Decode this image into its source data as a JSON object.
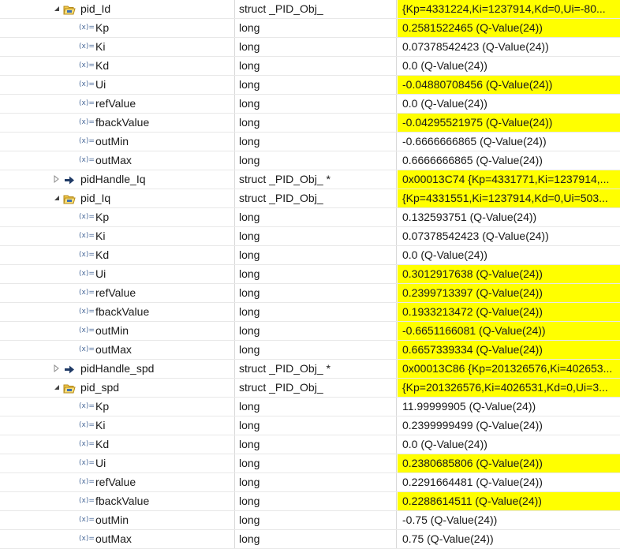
{
  "rows": [
    {
      "level": 1,
      "expand": "expanded",
      "icon": "struct-icon",
      "name": "pid_Id",
      "type": "struct _PID_Obj_",
      "value": "{Kp=4331224,Ki=1237914,Kd=0,Ui=-80...",
      "changed": true
    },
    {
      "level": 2,
      "expand": "none",
      "icon": "variable-icon",
      "name": "Kp",
      "type": "long",
      "value": "0.2581522465 (Q-Value(24))",
      "changed": true
    },
    {
      "level": 2,
      "expand": "none",
      "icon": "variable-icon",
      "name": "Ki",
      "type": "long",
      "value": "0.07378542423 (Q-Value(24))",
      "changed": false
    },
    {
      "level": 2,
      "expand": "none",
      "icon": "variable-icon",
      "name": "Kd",
      "type": "long",
      "value": "0.0 (Q-Value(24))",
      "changed": false
    },
    {
      "level": 2,
      "expand": "none",
      "icon": "variable-icon",
      "name": "Ui",
      "type": "long",
      "value": "-0.04880708456 (Q-Value(24))",
      "changed": true
    },
    {
      "level": 2,
      "expand": "none",
      "icon": "variable-icon",
      "name": "refValue",
      "type": "long",
      "value": "0.0 (Q-Value(24))",
      "changed": false
    },
    {
      "level": 2,
      "expand": "none",
      "icon": "variable-icon",
      "name": "fbackValue",
      "type": "long",
      "value": "-0.04295521975 (Q-Value(24))",
      "changed": true
    },
    {
      "level": 2,
      "expand": "none",
      "icon": "variable-icon",
      "name": "outMin",
      "type": "long",
      "value": "-0.6666666865 (Q-Value(24))",
      "changed": false
    },
    {
      "level": 2,
      "expand": "none",
      "icon": "variable-icon",
      "name": "outMax",
      "type": "long",
      "value": "0.6666666865 (Q-Value(24))",
      "changed": false
    },
    {
      "level": 1,
      "expand": "collapsed",
      "icon": "pointer-icon",
      "name": "pidHandle_Iq",
      "type": "struct _PID_Obj_ *",
      "value": "0x00013C74 {Kp=4331771,Ki=1237914,...",
      "changed": true
    },
    {
      "level": 1,
      "expand": "expanded",
      "icon": "struct-icon",
      "name": "pid_Iq",
      "type": "struct _PID_Obj_",
      "value": "{Kp=4331551,Ki=1237914,Kd=0,Ui=503...",
      "changed": true
    },
    {
      "level": 2,
      "expand": "none",
      "icon": "variable-icon",
      "name": "Kp",
      "type": "long",
      "value": "0.132593751 (Q-Value(24))",
      "changed": false
    },
    {
      "level": 2,
      "expand": "none",
      "icon": "variable-icon",
      "name": "Ki",
      "type": "long",
      "value": "0.07378542423 (Q-Value(24))",
      "changed": false
    },
    {
      "level": 2,
      "expand": "none",
      "icon": "variable-icon",
      "name": "Kd",
      "type": "long",
      "value": "0.0 (Q-Value(24))",
      "changed": false
    },
    {
      "level": 2,
      "expand": "none",
      "icon": "variable-icon",
      "name": "Ui",
      "type": "long",
      "value": "0.3012917638 (Q-Value(24))",
      "changed": true
    },
    {
      "level": 2,
      "expand": "none",
      "icon": "variable-icon",
      "name": "refValue",
      "type": "long",
      "value": "0.2399713397 (Q-Value(24))",
      "changed": true
    },
    {
      "level": 2,
      "expand": "none",
      "icon": "variable-icon",
      "name": "fbackValue",
      "type": "long",
      "value": "0.1933213472 (Q-Value(24))",
      "changed": true
    },
    {
      "level": 2,
      "expand": "none",
      "icon": "variable-icon",
      "name": "outMin",
      "type": "long",
      "value": "-0.6651166081 (Q-Value(24))",
      "changed": true
    },
    {
      "level": 2,
      "expand": "none",
      "icon": "variable-icon",
      "name": "outMax",
      "type": "long",
      "value": "0.6657339334 (Q-Value(24))",
      "changed": true
    },
    {
      "level": 1,
      "expand": "collapsed",
      "icon": "pointer-icon",
      "name": "pidHandle_spd",
      "type": "struct _PID_Obj_ *",
      "value": "0x00013C86 {Kp=201326576,Ki=402653...",
      "changed": true
    },
    {
      "level": 1,
      "expand": "expanded",
      "icon": "struct-icon",
      "name": "pid_spd",
      "type": "struct _PID_Obj_",
      "value": "{Kp=201326576,Ki=4026531,Kd=0,Ui=3...",
      "changed": true
    },
    {
      "level": 2,
      "expand": "none",
      "icon": "variable-icon",
      "name": "Kp",
      "type": "long",
      "value": "11.99999905 (Q-Value(24))",
      "changed": false
    },
    {
      "level": 2,
      "expand": "none",
      "icon": "variable-icon",
      "name": "Ki",
      "type": "long",
      "value": "0.2399999499 (Q-Value(24))",
      "changed": false
    },
    {
      "level": 2,
      "expand": "none",
      "icon": "variable-icon",
      "name": "Kd",
      "type": "long",
      "value": "0.0 (Q-Value(24))",
      "changed": false
    },
    {
      "level": 2,
      "expand": "none",
      "icon": "variable-icon",
      "name": "Ui",
      "type": "long",
      "value": "0.2380685806 (Q-Value(24))",
      "changed": true
    },
    {
      "level": 2,
      "expand": "none",
      "icon": "variable-icon",
      "name": "refValue",
      "type": "long",
      "value": "0.2291664481 (Q-Value(24))",
      "changed": false
    },
    {
      "level": 2,
      "expand": "none",
      "icon": "variable-icon",
      "name": "fbackValue",
      "type": "long",
      "value": "0.2288614511 (Q-Value(24))",
      "changed": true
    },
    {
      "level": 2,
      "expand": "none",
      "icon": "variable-icon",
      "name": "outMin",
      "type": "long",
      "value": "-0.75 (Q-Value(24))",
      "changed": false
    },
    {
      "level": 2,
      "expand": "none",
      "icon": "variable-icon",
      "name": "outMax",
      "type": "long",
      "value": "0.75 (Q-Value(24))",
      "changed": false
    }
  ],
  "colors": {
    "changed_highlight": "#ffff00",
    "grid_line": "#e8e8e8",
    "text": "#1a1a1a"
  }
}
